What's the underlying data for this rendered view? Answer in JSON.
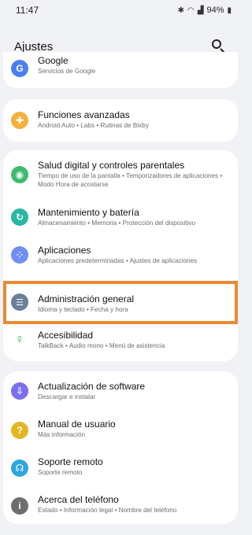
{
  "status": {
    "time": "11:47",
    "battery": "94%"
  },
  "header": {
    "title": "Ajustes"
  },
  "colors": {
    "accent_highlight": "#e98a35",
    "background": "#f1f2f6"
  },
  "groups": [
    {
      "items": [
        {
          "label": "Google",
          "sub": "Servicios de Google",
          "icon": "google-icon",
          "color": "#4a7ff2"
        }
      ]
    },
    {
      "items": [
        {
          "label": "Funciones avanzadas",
          "sub": "Android Auto  •  Labs  •  Rutinas de Bixby",
          "icon": "advanced-features-icon",
          "color": "#f4b13c"
        }
      ]
    },
    {
      "items": [
        {
          "label": "Salud digital y controles parentales",
          "sub": "Tiempo de uso de la pantalla  •  Temporizadores de aplicaciones  •  Modo Hora de acostarse",
          "icon": "digital-wellbeing-icon",
          "color": "#3dbb6e"
        },
        {
          "label": "Mantenimiento y batería",
          "sub": "Almacenamiento  •  Memoria  •  Protección del dispositivo",
          "icon": "device-care-icon",
          "color": "#28b7a3"
        },
        {
          "label": "Aplicaciones",
          "sub": "Aplicaciones predeterminadas  •  Ajustes de aplicaciones",
          "icon": "apps-icon",
          "color": "#6f8ff2"
        },
        {
          "label": "Administración general",
          "sub": "Idioma y teclado  •  Fecha y hora",
          "icon": "sliders-icon",
          "color": "#6b7f99"
        },
        {
          "label": "Accesibilidad",
          "sub": "TalkBack  •  Audio mono  •  Menú de asistencia",
          "icon": "accessibility-icon",
          "color": "#3aa854"
        }
      ]
    },
    {
      "items": [
        {
          "label": "Actualización de software",
          "sub": "Descargar e instalar",
          "icon": "software-update-icon",
          "color": "#7b6ff0"
        },
        {
          "label": "Manual de usuario",
          "sub": "Más información",
          "icon": "user-manual-icon",
          "color": "#e5b623"
        },
        {
          "label": "Soporte remoto",
          "sub": "Soporte remoto",
          "icon": "remote-support-icon",
          "color": "#2ea6e0"
        },
        {
          "label": "Acerca del teléfono",
          "sub": "Estado  •  Información legal  •  Nombre del teléfono",
          "icon": "about-phone-icon",
          "color": "#6e6e6e"
        }
      ]
    }
  ]
}
